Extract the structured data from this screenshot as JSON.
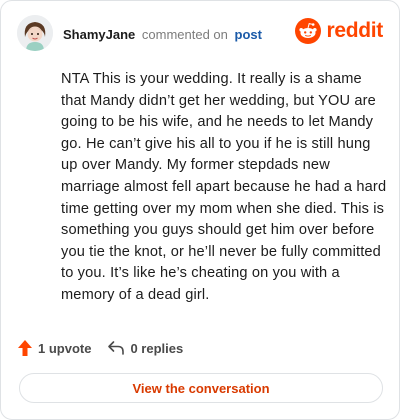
{
  "header": {
    "author": "ShamyJane",
    "action_text": "commented on",
    "post_link": "post",
    "brand": "reddit"
  },
  "comment": {
    "text": "NTA This is your wedding. It really is a shame that Mandy didn’t get her wedding, but YOU are going to be his wife, and he needs to let Mandy go. He can’t give his all to you if he is still hung up over Mandy. My former stepdads new marriage almost fell apart because he had a hard time getting over my mom when she died. This is something you guys should get him over before you tie the knot, or he’ll never be fully committed to you. It’s like he’s cheating on you with a memory of a dead girl."
  },
  "actions": {
    "upvotes": "1 upvote",
    "replies": "0 replies"
  },
  "footer": {
    "view_button": "View the conversation"
  },
  "icons": {
    "upvote": "upvote-arrow-icon",
    "reply": "reply-arrow-icon",
    "brand": "reddit-snoo-icon"
  },
  "colors": {
    "brand": "#ff4500",
    "upvote": "#ff4500",
    "link": "#1a5aa8",
    "button_text": "#d93a00"
  }
}
